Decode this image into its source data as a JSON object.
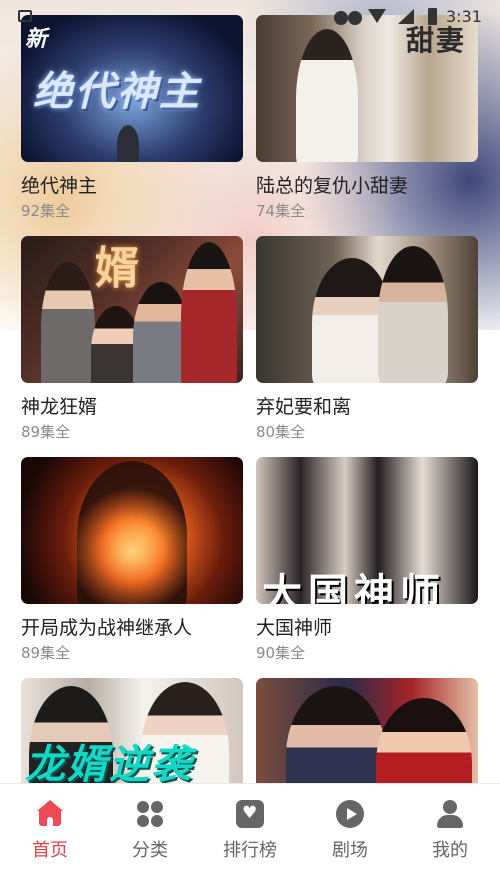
{
  "status_bar": {
    "time": "3:31",
    "icons": [
      "app-notification-icon",
      "status-dot-icon",
      "status-dot-icon",
      "wifi-icon",
      "signal-icon",
      "battery-icon"
    ]
  },
  "dramas": [
    {
      "title": "绝代神主",
      "episodes": "92集全",
      "poster_text": "绝代神主",
      "badge": "新"
    },
    {
      "title": "陆总的复仇小甜妻",
      "episodes": "74集全",
      "poster_text": "甜妻"
    },
    {
      "title": "神龙狂婿",
      "episodes": "89集全",
      "poster_text": "婿"
    },
    {
      "title": "弃妃要和离",
      "episodes": "80集全"
    },
    {
      "title": "开局成为战神继承人",
      "episodes": "89集全"
    },
    {
      "title": "大国神师",
      "episodes": "90集全",
      "poster_text": "大国神师"
    },
    {
      "title": "",
      "episodes": "",
      "poster_text": "龙婿逆袭"
    },
    {
      "title": "",
      "episodes": ""
    }
  ],
  "tab_bar": {
    "tabs": [
      {
        "label": "首页",
        "icon": "home-icon",
        "active": true
      },
      {
        "label": "分类",
        "icon": "category-icon",
        "active": false
      },
      {
        "label": "排行榜",
        "icon": "ranking-icon",
        "active": false
      },
      {
        "label": "剧场",
        "icon": "theater-play-icon",
        "active": false
      },
      {
        "label": "我的",
        "icon": "profile-icon",
        "active": false
      }
    ]
  },
  "colors": {
    "accent": "#e5404b",
    "text_primary": "#222222",
    "text_secondary": "#8a8a8a",
    "tab_inactive": "#666666"
  }
}
